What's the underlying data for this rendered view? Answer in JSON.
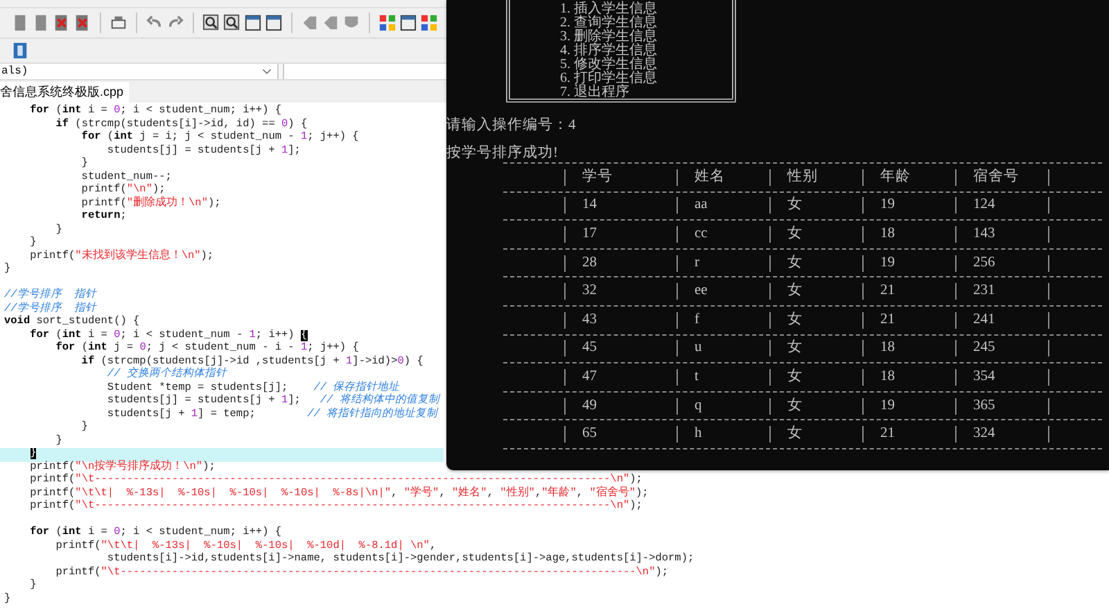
{
  "scope_field": {
    "value": "als)"
  },
  "file_tab": {
    "label": "舍信息系统终极版.cpp",
    "selected": true
  },
  "code_lines": [
    {
      "current": false,
      "parts": [
        {
          "kind": "keyword",
          "text": "    for"
        },
        {
          "kind": "plain",
          "text": " ("
        },
        {
          "kind": "keyword",
          "text": "int"
        },
        {
          "kind": "plain",
          "text": " i = "
        },
        {
          "kind": "number",
          "text": "0"
        },
        {
          "kind": "plain",
          "text": "; i < student_num; i++) {"
        }
      ]
    },
    {
      "current": false,
      "parts": [
        {
          "kind": "keyword",
          "text": "        if"
        },
        {
          "kind": "plain",
          "text": " (strcmp(students[i]->id, id) == "
        },
        {
          "kind": "number",
          "text": "0"
        },
        {
          "kind": "plain",
          "text": ") {"
        }
      ]
    },
    {
      "current": false,
      "parts": [
        {
          "kind": "keyword",
          "text": "            for"
        },
        {
          "kind": "plain",
          "text": " ("
        },
        {
          "kind": "keyword",
          "text": "int"
        },
        {
          "kind": "plain",
          "text": " j = i; j < student_num - "
        },
        {
          "kind": "number",
          "text": "1"
        },
        {
          "kind": "plain",
          "text": "; j++) {"
        }
      ]
    },
    {
      "current": false,
      "parts": [
        {
          "kind": "plain",
          "text": "                students[j] = students[j + "
        },
        {
          "kind": "number",
          "text": "1"
        },
        {
          "kind": "plain",
          "text": "];"
        }
      ]
    },
    {
      "current": false,
      "parts": [
        {
          "kind": "plain",
          "text": "            }"
        }
      ]
    },
    {
      "current": false,
      "parts": [
        {
          "kind": "plain",
          "text": "            student_num--;"
        }
      ]
    },
    {
      "current": false,
      "parts": [
        {
          "kind": "plain",
          "text": "            printf("
        },
        {
          "kind": "string",
          "text": "\"\\n\""
        },
        {
          "kind": "plain",
          "text": ");"
        }
      ]
    },
    {
      "current": false,
      "parts": [
        {
          "kind": "plain",
          "text": "            printf("
        },
        {
          "kind": "string",
          "text": "\"删除成功！\\n\""
        },
        {
          "kind": "plain",
          "text": ");"
        }
      ]
    },
    {
      "current": false,
      "parts": [
        {
          "kind": "keyword",
          "text": "            return"
        },
        {
          "kind": "plain",
          "text": ";"
        }
      ]
    },
    {
      "current": false,
      "parts": [
        {
          "kind": "plain",
          "text": "        }"
        }
      ]
    },
    {
      "current": false,
      "parts": [
        {
          "kind": "plain",
          "text": "    }"
        }
      ]
    },
    {
      "current": false,
      "parts": [
        {
          "kind": "plain",
          "text": "    printf("
        },
        {
          "kind": "string",
          "text": "\"未找到该学生信息！\\n\""
        },
        {
          "kind": "plain",
          "text": ");"
        }
      ]
    },
    {
      "current": false,
      "parts": [
        {
          "kind": "plain",
          "text": "}"
        }
      ]
    },
    {
      "current": false,
      "blank_before": true,
      "parts": [
        {
          "kind": "comment",
          "text": "//学号排序  指针"
        }
      ]
    },
    {
      "current": false,
      "parts": [
        {
          "kind": "comment",
          "text": "//学号排序  指针"
        }
      ]
    },
    {
      "current": false,
      "parts": [
        {
          "kind": "keyword",
          "text": "void"
        },
        {
          "kind": "plain",
          "text": " sort_student() {"
        }
      ]
    },
    {
      "current": false,
      "parts": [
        {
          "kind": "keyword",
          "text": "    for"
        },
        {
          "kind": "plain",
          "text": " ("
        },
        {
          "kind": "keyword",
          "text": "int"
        },
        {
          "kind": "plain",
          "text": " i = "
        },
        {
          "kind": "number",
          "text": "0"
        },
        {
          "kind": "plain",
          "text": "; i < student_num - "
        },
        {
          "kind": "number",
          "text": "1"
        },
        {
          "kind": "plain",
          "text": "; i++) "
        },
        {
          "kind": "match",
          "text": "{"
        }
      ]
    },
    {
      "current": false,
      "parts": [
        {
          "kind": "keyword",
          "text": "        for"
        },
        {
          "kind": "plain",
          "text": " ("
        },
        {
          "kind": "keyword",
          "text": "int"
        },
        {
          "kind": "plain",
          "text": " j = "
        },
        {
          "kind": "number",
          "text": "0"
        },
        {
          "kind": "plain",
          "text": "; j < student_num - i - "
        },
        {
          "kind": "number",
          "text": "1"
        },
        {
          "kind": "plain",
          "text": "; j++) {"
        }
      ]
    },
    {
      "current": false,
      "parts": [
        {
          "kind": "keyword",
          "text": "            if"
        },
        {
          "kind": "plain",
          "text": " (strcmp(students[j]->id ,students[j + "
        },
        {
          "kind": "number",
          "text": "1"
        },
        {
          "kind": "plain",
          "text": "]->id)>"
        },
        {
          "kind": "number",
          "text": "0"
        },
        {
          "kind": "plain",
          "text": ") {"
        }
      ]
    },
    {
      "current": false,
      "parts": [
        {
          "kind": "comment",
          "text": "                // 交换两个结构体指针"
        }
      ]
    },
    {
      "current": false,
      "parts": [
        {
          "kind": "plain",
          "text": "                Student *temp = students[j];    "
        },
        {
          "kind": "comment",
          "text": "// 保存指针地址"
        }
      ]
    },
    {
      "current": false,
      "parts": [
        {
          "kind": "plain",
          "text": "                students[j] = students[j + "
        },
        {
          "kind": "number",
          "text": "1"
        },
        {
          "kind": "plain",
          "text": "];   "
        },
        {
          "kind": "comment",
          "text": "// 将结构体中的值复制"
        }
      ]
    },
    {
      "current": false,
      "parts": [
        {
          "kind": "plain",
          "text": "                students[j + "
        },
        {
          "kind": "number",
          "text": "1"
        },
        {
          "kind": "plain",
          "text": "] = temp;        "
        },
        {
          "kind": "comment",
          "text": "// 将指针指向的地址复制"
        }
      ]
    },
    {
      "current": false,
      "parts": [
        {
          "kind": "plain",
          "text": "            }"
        }
      ]
    },
    {
      "current": false,
      "parts": [
        {
          "kind": "plain",
          "text": "        }"
        }
      ]
    },
    {
      "current": true,
      "parts": [
        {
          "kind": "match",
          "text": "    }"
        }
      ]
    },
    {
      "current": false,
      "parts": [
        {
          "kind": "plain",
          "text": "    printf("
        },
        {
          "kind": "string",
          "text": "\"\\n按学号排序成功！\\n\""
        },
        {
          "kind": "plain",
          "text": ");"
        }
      ]
    },
    {
      "current": false,
      "parts": [
        {
          "kind": "plain",
          "text": "    printf("
        },
        {
          "kind": "string",
          "text": "\"\\t--------------------------------------------------------------------------------\\n\""
        },
        {
          "kind": "plain",
          "text": ");"
        }
      ]
    },
    {
      "current": false,
      "parts": [
        {
          "kind": "plain",
          "text": "    printf("
        },
        {
          "kind": "string",
          "text": "\"\\t\\t|  %-13s|  %-10s|  %-10s|  %-10s|  %-8s|\\n|\""
        },
        {
          "kind": "plain",
          "text": ", "
        },
        {
          "kind": "string",
          "text": "\"学号\""
        },
        {
          "kind": "plain",
          "text": ", "
        },
        {
          "kind": "string",
          "text": "\"姓名\""
        },
        {
          "kind": "plain",
          "text": ", "
        },
        {
          "kind": "string",
          "text": "\"性别\""
        },
        {
          "kind": "plain",
          "text": ","
        },
        {
          "kind": "string",
          "text": "\"年龄\""
        },
        {
          "kind": "plain",
          "text": ", "
        },
        {
          "kind": "string",
          "text": "\"宿舍号\""
        },
        {
          "kind": "plain",
          "text": ");"
        }
      ]
    },
    {
      "current": false,
      "parts": [
        {
          "kind": "plain",
          "text": "    printf("
        },
        {
          "kind": "string",
          "text": "\"\\t--------------------------------------------------------------------------------\\n\""
        },
        {
          "kind": "plain",
          "text": ");"
        }
      ]
    },
    {
      "current": false,
      "blank_before": true,
      "parts": [
        {
          "kind": "keyword",
          "text": "    for"
        },
        {
          "kind": "plain",
          "text": " ("
        },
        {
          "kind": "keyword",
          "text": "int"
        },
        {
          "kind": "plain",
          "text": " i = "
        },
        {
          "kind": "number",
          "text": "0"
        },
        {
          "kind": "plain",
          "text": "; i < student_num; i++) {"
        }
      ]
    },
    {
      "current": false,
      "parts": [
        {
          "kind": "plain",
          "text": "        printf("
        },
        {
          "kind": "string",
          "text": "\"\\t\\t|  %-13s|  %-10s|  %-10s|  %-10d|  %-8.1d| \\n\""
        },
        {
          "kind": "plain",
          "text": ","
        }
      ]
    },
    {
      "current": false,
      "parts": [
        {
          "kind": "plain",
          "text": "                students[i]->id,students[i]->name, students[i]->gender,students[i]->age,students[i]->dorm);"
        }
      ]
    },
    {
      "current": false,
      "parts": [
        {
          "kind": "plain",
          "text": "        printf("
        },
        {
          "kind": "string",
          "text": "\"\\t--------------------------------------------------------------------------------\\n\""
        },
        {
          "kind": "plain",
          "text": ");"
        }
      ]
    },
    {
      "current": false,
      "parts": [
        {
          "kind": "plain",
          "text": "    }"
        }
      ]
    },
    {
      "current": false,
      "parts": [
        {
          "kind": "plain",
          "text": "}"
        }
      ]
    }
  ],
  "console": {
    "menu_items": [
      "1. 插入学生信息",
      "2. 查询学生信息",
      "3. 删除学生信息",
      "4. 排序学生信息",
      "5. 修改学生信息",
      "6. 打印学生信息",
      "7. 退出程序"
    ],
    "prompt": "请输入操作编号：4",
    "message": "按学号排序成功!",
    "table": {
      "columns": [
        "学号",
        "姓名",
        "性别",
        "年龄",
        "宿舍号"
      ],
      "rows": [
        [
          "14",
          "aa",
          "女",
          "19",
          "124"
        ],
        [
          "17",
          "cc",
          "女",
          "18",
          "143"
        ],
        [
          "28",
          "r",
          "女",
          "19",
          "256"
        ],
        [
          "32",
          "ee",
          "女",
          "21",
          "231"
        ],
        [
          "43",
          "f",
          "女",
          "21",
          "241"
        ],
        [
          "45",
          "u",
          "女",
          "18",
          "245"
        ],
        [
          "47",
          "t",
          "女",
          "18",
          "354"
        ],
        [
          "49",
          "q",
          "女",
          "19",
          "365"
        ],
        [
          "65",
          "h",
          "女",
          "21",
          "324"
        ]
      ]
    }
  }
}
